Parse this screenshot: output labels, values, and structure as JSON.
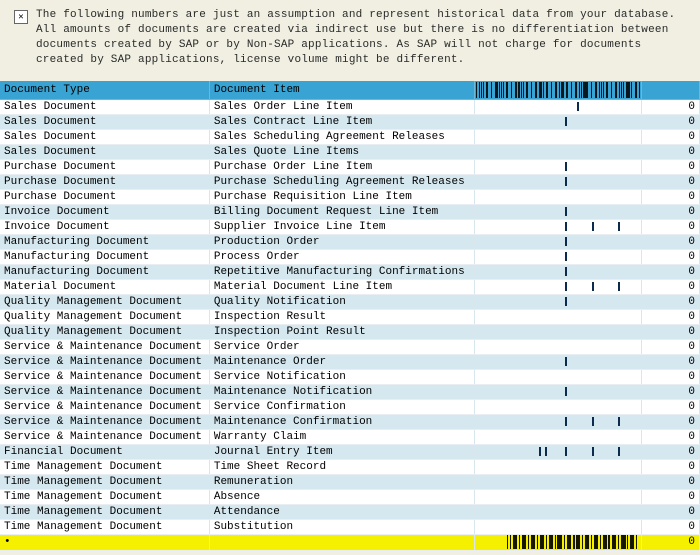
{
  "notice": {
    "text": "The following numbers are just an assumption and represent historical data from your database. All amounts of documents are created via indirect use but there is no differentiation between documents created by SAP or by Non-SAP applications. As SAP will not charge for documents created by SAP applications, license volume might be different."
  },
  "table": {
    "headers": {
      "doctype": "Document Type",
      "docitem": "Document Item",
      "bar": "",
      "num": ""
    },
    "rows": [
      {
        "doctype": "Sales Document",
        "docitem": "Sales Order Line Item",
        "num": "0",
        "ticks": [
          62
        ]
      },
      {
        "doctype": "Sales Document",
        "docitem": "Sales Contract Line Item",
        "num": "0",
        "ticks": [
          55
        ]
      },
      {
        "doctype": "Sales Document",
        "docitem": "Sales Scheduling Agreement Releases",
        "num": "0",
        "ticks": []
      },
      {
        "doctype": "Sales Document",
        "docitem": "Sales Quote Line Items",
        "num": "0",
        "ticks": []
      },
      {
        "doctype": "Purchase Document",
        "docitem": "Purchase Order Line Item",
        "num": "0",
        "ticks": [
          55
        ]
      },
      {
        "doctype": "Purchase Document",
        "docitem": "Purchase Scheduling Agreement Releases",
        "num": "0",
        "ticks": [
          55
        ]
      },
      {
        "doctype": "Purchase Document",
        "docitem": "Purchase Requisition Line Item",
        "num": "0",
        "ticks": []
      },
      {
        "doctype": "Invoice Document",
        "docitem": "Billing Document Request Line Item",
        "num": "0",
        "ticks": [
          55
        ]
      },
      {
        "doctype": "Invoice Document",
        "docitem": "Supplier Invoice Line Item",
        "num": "0",
        "ticks": [
          55,
          72,
          88
        ]
      },
      {
        "doctype": "Manufacturing Document",
        "docitem": "Production Order",
        "num": "0",
        "ticks": [
          55
        ]
      },
      {
        "doctype": "Manufacturing Document",
        "docitem": "Process Order",
        "num": "0",
        "ticks": [
          55
        ]
      },
      {
        "doctype": "Manufacturing Document",
        "docitem": "Repetitive Manufacturing Confirmations",
        "num": "0",
        "ticks": [
          55
        ]
      },
      {
        "doctype": "Material Document",
        "docitem": "Material Document Line Item",
        "num": "0",
        "ticks": [
          55,
          72,
          88
        ]
      },
      {
        "doctype": "Quality Management Document",
        "docitem": "Quality Notification",
        "num": "0",
        "ticks": [
          55
        ]
      },
      {
        "doctype": "Quality Management Document",
        "docitem": "Inspection Result",
        "num": "0",
        "ticks": []
      },
      {
        "doctype": "Quality Management Document",
        "docitem": "Inspection Point Result",
        "num": "0",
        "ticks": []
      },
      {
        "doctype": "Service & Maintenance Document",
        "docitem": "Service Order",
        "num": "0",
        "ticks": []
      },
      {
        "doctype": "Service & Maintenance Document",
        "docitem": "Maintenance Order",
        "num": "0",
        "ticks": [
          55
        ]
      },
      {
        "doctype": "Service & Maintenance Document",
        "docitem": "Service Notification",
        "num": "0",
        "ticks": []
      },
      {
        "doctype": "Service & Maintenance Document",
        "docitem": "Maintenance Notification",
        "num": "0",
        "ticks": [
          55
        ]
      },
      {
        "doctype": "Service & Maintenance Document",
        "docitem": "Service Confirmation",
        "num": "0",
        "ticks": []
      },
      {
        "doctype": "Service & Maintenance Document",
        "docitem": "Maintenance Confirmation",
        "num": "0",
        "ticks": [
          55,
          72,
          88
        ]
      },
      {
        "doctype": "Service & Maintenance Document",
        "docitem": "Warranty Claim",
        "num": "0",
        "ticks": []
      },
      {
        "doctype": "Financial Document",
        "docitem": "Journal Entry Item",
        "num": "0",
        "ticks": [
          38,
          42,
          55,
          72,
          88
        ]
      },
      {
        "doctype": "Time Management Document",
        "docitem": "Time Sheet Record",
        "num": "0",
        "ticks": []
      },
      {
        "doctype": "Time Management Document",
        "docitem": "Remuneration",
        "num": "0",
        "ticks": []
      },
      {
        "doctype": "Time Management Document",
        "docitem": "Absence",
        "num": "0",
        "ticks": []
      },
      {
        "doctype": "Time Management Document",
        "docitem": "Attendance",
        "num": "0",
        "ticks": []
      },
      {
        "doctype": "Time Management Document",
        "docitem": "Substitution",
        "num": "0",
        "ticks": []
      }
    ],
    "footer": {
      "marker": "•",
      "num": "0"
    }
  }
}
